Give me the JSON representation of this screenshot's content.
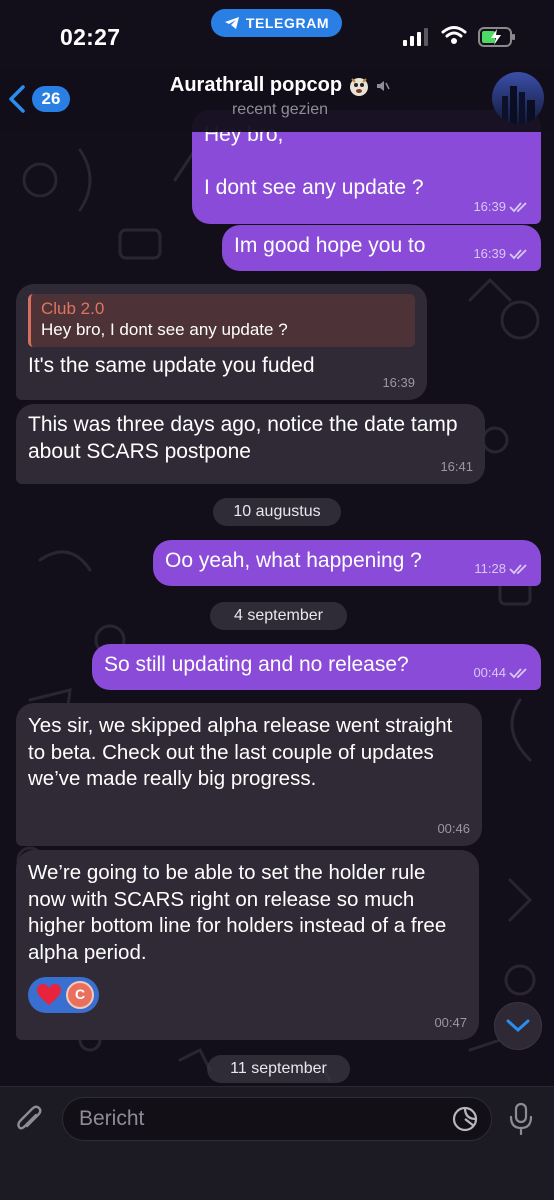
{
  "status_bar": {
    "time": "02:27",
    "app_pill": "TELEGRAM"
  },
  "header": {
    "back_count": "26",
    "title": "Aurathrall popcop",
    "subtitle": "recent gezien"
  },
  "messages": [
    {
      "dir": "out",
      "text": "Hey bro,\n\nI dont see any update ?",
      "time": "16:39"
    },
    {
      "dir": "out",
      "text": "Im good hope you to",
      "time": "16:39"
    },
    {
      "dir": "in",
      "reply_author": "Club 2.0",
      "reply_text": "Hey bro, I dont see any update ?",
      "text": "It's the same update you fuded",
      "time": "16:39"
    },
    {
      "dir": "in",
      "text": "This was three days ago, notice the date tamp about SCARS postpone",
      "time": "16:41"
    },
    {
      "dir": "out",
      "text": "Oo yeah, what happening ?",
      "time": "11:28"
    },
    {
      "dir": "out",
      "text": "So still updating and no release?",
      "time": "00:44"
    },
    {
      "dir": "in",
      "text": "Yes sir, we skipped alpha release went straight to beta. Check out the last couple of updates we’ve made really big progress.",
      "time": "00:46"
    },
    {
      "dir": "in",
      "text": "We’re going to be able to set the holder rule now with SCARS right on release so much higher bottom line for holders instead of a free alpha period.",
      "time": "00:47",
      "reaction_avatar": "C"
    }
  ],
  "dates": [
    "10 augustus",
    "4 september",
    "11 september"
  ],
  "composer": {
    "placeholder": "Bericht"
  },
  "colors": {
    "outgoing": "#8a4cd8",
    "incoming": "#2f2a35",
    "accent": "#2a7fe4",
    "reply_accent": "#e0755f"
  }
}
